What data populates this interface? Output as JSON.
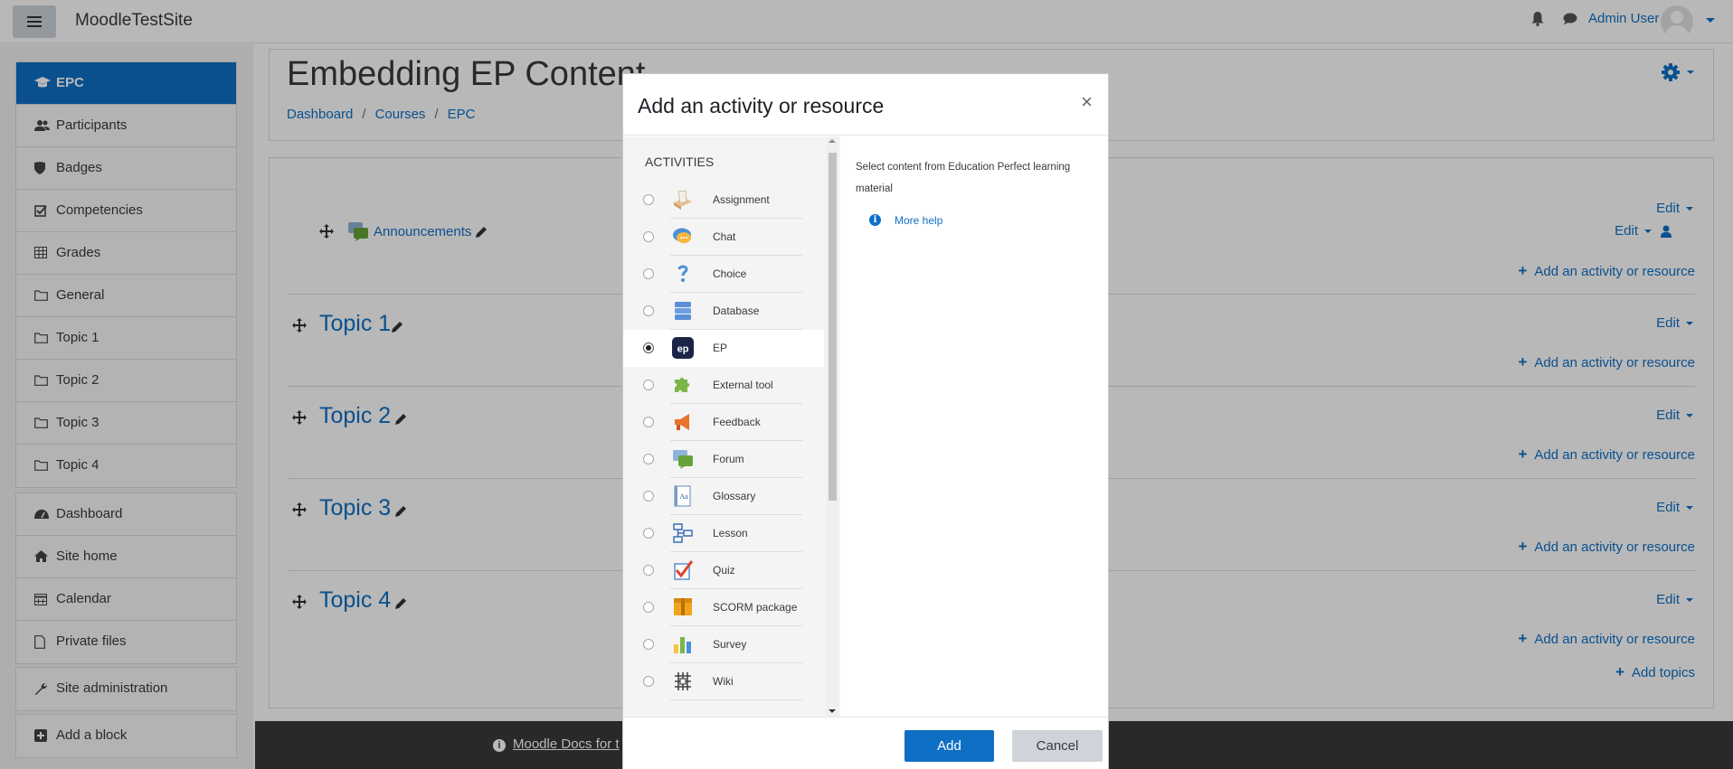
{
  "navbar": {
    "site_name": "MoodleTestSite",
    "user_name": "Admin User"
  },
  "drawer": {
    "course_items": [
      {
        "label": "EPC",
        "icon": "graduation-cap-icon",
        "active": true
      },
      {
        "label": "Participants",
        "icon": "users-icon"
      },
      {
        "label": "Badges",
        "icon": "shield-icon"
      },
      {
        "label": "Competencies",
        "icon": "check-square-icon"
      },
      {
        "label": "Grades",
        "icon": "table-icon"
      },
      {
        "label": "General",
        "icon": "folder-icon"
      },
      {
        "label": "Topic 1",
        "icon": "folder-icon"
      },
      {
        "label": "Topic 2",
        "icon": "folder-icon"
      },
      {
        "label": "Topic 3",
        "icon": "folder-icon"
      },
      {
        "label": "Topic 4",
        "icon": "folder-icon"
      }
    ],
    "site_items": [
      {
        "label": "Dashboard",
        "icon": "dashboard-icon"
      },
      {
        "label": "Site home",
        "icon": "home-icon"
      },
      {
        "label": "Calendar",
        "icon": "calendar-icon"
      },
      {
        "label": "Private files",
        "icon": "file-icon"
      }
    ],
    "admin_items": [
      {
        "label": "Site administration",
        "icon": "wrench-icon"
      }
    ],
    "block_items": [
      {
        "label": "Add a block",
        "icon": "plus-square-icon"
      }
    ]
  },
  "page": {
    "title": "Embedding EP Content",
    "breadcrumb": [
      "Dashboard",
      "Courses",
      "EPC"
    ]
  },
  "course": {
    "announcements": "Announcements",
    "topics": [
      "Topic 1",
      "Topic 2",
      "Topic 3",
      "Topic 4"
    ],
    "edit_label": "Edit",
    "add_activity_label": "Add an activity or resource",
    "add_topics_label": "Add topics"
  },
  "footer": {
    "text": "Moodle Docs for t"
  },
  "modal": {
    "title": "Add an activity or resource",
    "close_glyph": "×",
    "section_heading": "ACTIVITIES",
    "options": [
      {
        "label": "Assignment",
        "icon": "assignment-icon"
      },
      {
        "label": "Chat",
        "icon": "chat-icon"
      },
      {
        "label": "Choice",
        "icon": "choice-icon"
      },
      {
        "label": "Database",
        "icon": "database-icon"
      },
      {
        "label": "EP",
        "icon": "ep-icon",
        "selected": true
      },
      {
        "label": "External tool",
        "icon": "puzzle-icon"
      },
      {
        "label": "Feedback",
        "icon": "megaphone-icon"
      },
      {
        "label": "Forum",
        "icon": "forum-icon"
      },
      {
        "label": "Glossary",
        "icon": "glossary-icon"
      },
      {
        "label": "Lesson",
        "icon": "lesson-icon"
      },
      {
        "label": "Quiz",
        "icon": "quiz-icon"
      },
      {
        "label": "SCORM package",
        "icon": "scorm-icon"
      },
      {
        "label": "Survey",
        "icon": "survey-icon"
      },
      {
        "label": "Wiki",
        "icon": "wiki-icon"
      }
    ],
    "help_description": "Select content from Education Perfect learning material",
    "more_help": "More help",
    "add_button": "Add",
    "cancel_button": "Cancel"
  },
  "colors": {
    "brand": "#0f6fc5",
    "backdrop": "rgba(0,0,0,0.28)",
    "footer": "#373a3c"
  }
}
